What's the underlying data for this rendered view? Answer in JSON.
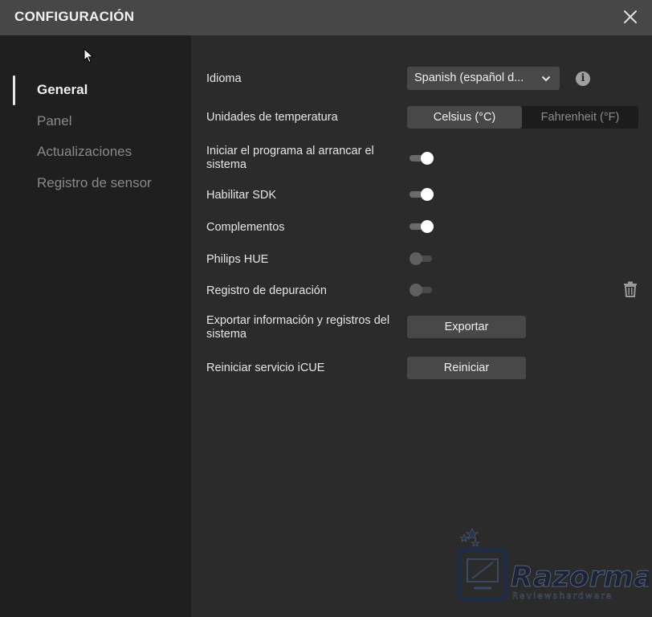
{
  "window": {
    "title": "CONFIGURACIÓN"
  },
  "sidebar": {
    "items": [
      {
        "label": "General",
        "active": true
      },
      {
        "label": "Panel",
        "active": false
      },
      {
        "label": "Actualizaciones",
        "active": false
      },
      {
        "label": "Registro de sensor",
        "active": false
      }
    ]
  },
  "settings": {
    "language": {
      "label": "Idioma",
      "value": "Spanish (español d..."
    },
    "temperature": {
      "label": "Unidades de temperatura",
      "options": [
        "Celsius (°C)",
        "Fahrenheit (°F)"
      ],
      "selected": "Celsius (°C)"
    },
    "startup": {
      "label": "Iniciar el programa al arrancar el sistema",
      "enabled": true
    },
    "sdk": {
      "label": "Habilitar SDK",
      "enabled": true
    },
    "plugins": {
      "label": "Complementos",
      "enabled": true
    },
    "philips": {
      "label": "Philips HUE",
      "enabled": false
    },
    "debug": {
      "label": "Registro de depuración",
      "enabled": false
    },
    "export": {
      "label": "Exportar información y registros del sistema",
      "button": "Exportar"
    },
    "restart": {
      "label": "Reiniciar servicio iCUE",
      "button": "Reiniciar"
    }
  },
  "watermark": {
    "brand": "Razorman",
    "tagline": "Reviewshardware"
  },
  "colors": {
    "titlebar": "#474747",
    "sidebar": "#1f1f1f",
    "main": "#2b2b2b",
    "control": "#484848"
  }
}
